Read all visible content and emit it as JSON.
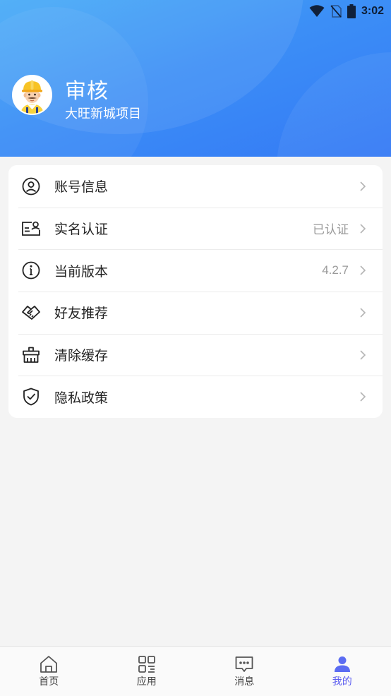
{
  "status_bar": {
    "time": "3:02",
    "icons": [
      "wifi-icon",
      "no-sim-icon",
      "battery-icon"
    ]
  },
  "profile": {
    "name": "审核",
    "project": "大旺新城项目",
    "avatar_icon": "worker-avatar-icon"
  },
  "menu": {
    "items": [
      {
        "label": "账号信息",
        "value": "",
        "icon": "user-circle-icon"
      },
      {
        "label": "实名认证",
        "value": "已认证",
        "icon": "id-card-icon"
      },
      {
        "label": "当前版本",
        "value": "4.2.7",
        "icon": "info-icon"
      },
      {
        "label": "好友推荐",
        "value": "",
        "icon": "handshake-icon"
      },
      {
        "label": "清除缓存",
        "value": "",
        "icon": "broom-icon"
      },
      {
        "label": "隐私政策",
        "value": "",
        "icon": "shield-check-icon"
      }
    ]
  },
  "bottom_nav": {
    "items": [
      {
        "label": "首页",
        "icon": "home-icon",
        "active": false
      },
      {
        "label": "应用",
        "icon": "apps-icon",
        "active": false
      },
      {
        "label": "消息",
        "icon": "message-icon",
        "active": false
      },
      {
        "label": "我的",
        "icon": "person-icon",
        "active": true
      }
    ]
  },
  "colors": {
    "header_gradient_start": "#45aaf7",
    "header_gradient_end": "#3479f5",
    "active_tab": "#5b5cf0",
    "background": "#f4f4f4"
  }
}
